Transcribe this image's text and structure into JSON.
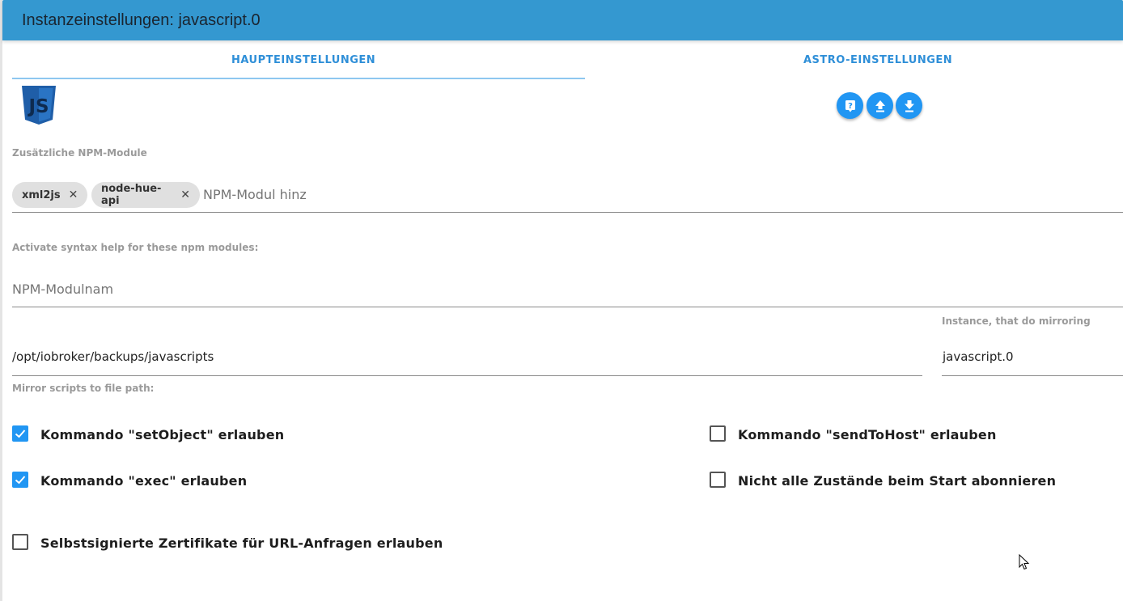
{
  "header": {
    "title": "Instanzeinstellungen: javascript.0"
  },
  "tabs": [
    {
      "label": "HAUPTEINSTELLUNGEN",
      "active": true
    },
    {
      "label": "ASTRO-EINSTELLUNGEN",
      "active": false
    }
  ],
  "logo": {
    "text": "JS"
  },
  "toolbar": {
    "icons": [
      "help-icon",
      "upload-icon",
      "download-icon"
    ]
  },
  "npm_modules": {
    "label": "Zusätzliche NPM-Module",
    "chips": [
      "xml2js",
      "node-hue-api"
    ],
    "placeholder": "NPM-Modul hinz"
  },
  "syntax_help": {
    "label": "Activate syntax help for these npm modules:",
    "placeholder": "NPM-Modulnam"
  },
  "mirror": {
    "path_value": "/opt/iobroker/backups/javascripts",
    "path_label": "Mirror scripts to file path:",
    "instance_label": "Instance, that do mirroring",
    "instance_value": "javascript.0"
  },
  "checkboxes": [
    {
      "label": "Kommando \"setObject\" erlauben",
      "checked": true
    },
    {
      "label": "Kommando \"sendToHost\" erlauben",
      "checked": false
    },
    {
      "label": "Kommando \"exec\" erlauben",
      "checked": true
    },
    {
      "label": "Nicht alle Zustände beim Start abonnieren",
      "checked": false
    },
    {
      "label": "Selbstsignierte Zertifikate für URL-Anfragen erlauben",
      "checked": false
    }
  ],
  "colors": {
    "header": "#3498d0",
    "accent": "#2196f3",
    "tab_text": "#2f8fd8"
  }
}
